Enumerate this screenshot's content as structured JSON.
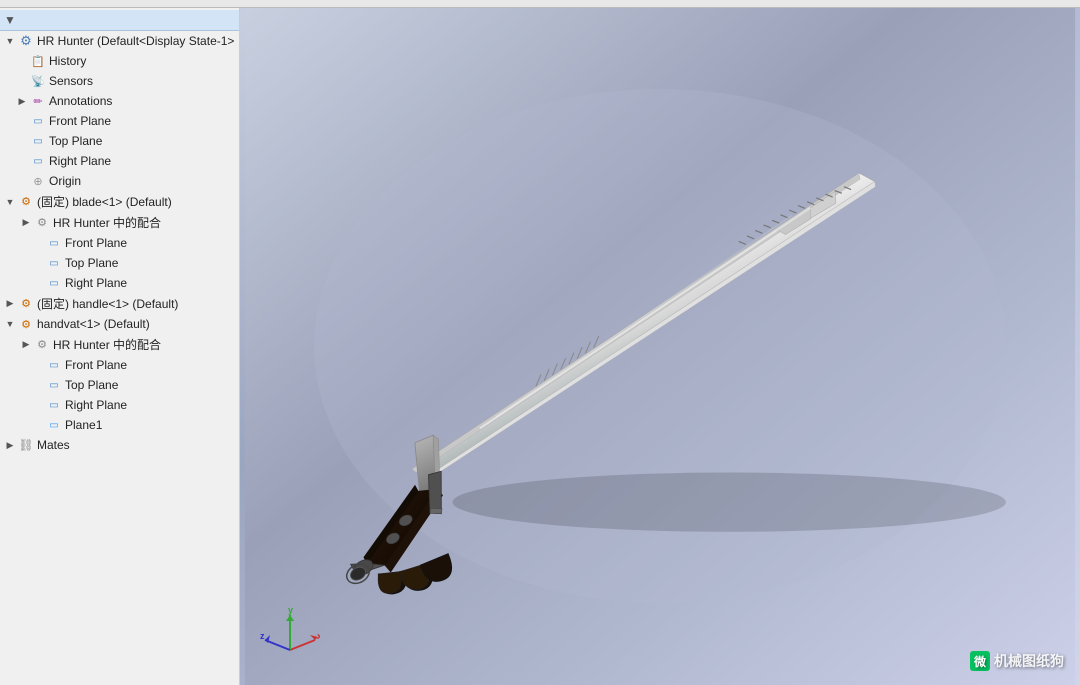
{
  "toolbar": {
    "filter_icon": "▼"
  },
  "sidebar": {
    "root_item": "HR Hunter  (Default<Display State-1>",
    "items": [
      {
        "id": "history",
        "label": "History",
        "icon": "H",
        "indent": 1,
        "type": "history",
        "expanded": false
      },
      {
        "id": "sensors",
        "label": "Sensors",
        "icon": "S",
        "indent": 1,
        "type": "sensor",
        "expanded": false
      },
      {
        "id": "annotations",
        "label": "Annotations",
        "icon": "A",
        "indent": 1,
        "type": "annotation",
        "expanded": false,
        "has_arrow": true
      },
      {
        "id": "front-plane",
        "label": "Front Plane",
        "icon": "P",
        "indent": 1,
        "type": "plane"
      },
      {
        "id": "top-plane",
        "label": "Top Plane",
        "icon": "P",
        "indent": 1,
        "type": "plane"
      },
      {
        "id": "right-plane",
        "label": "Right Plane",
        "icon": "P",
        "indent": 1,
        "type": "plane"
      },
      {
        "id": "origin",
        "label": "Origin",
        "icon": "O",
        "indent": 1,
        "type": "origin"
      },
      {
        "id": "blade",
        "label": "(固定) blade<1> (Default)",
        "icon": "C",
        "indent": 0,
        "type": "assembly",
        "expanded": true,
        "has_arrow": true
      },
      {
        "id": "blade-mate",
        "label": "HR Hunter 中的配合",
        "icon": "M",
        "indent": 2,
        "type": "mate",
        "expanded": false,
        "has_arrow": true
      },
      {
        "id": "blade-front",
        "label": "Front Plane",
        "icon": "P",
        "indent": 2,
        "type": "plane"
      },
      {
        "id": "blade-top",
        "label": "Top Plane",
        "icon": "P",
        "indent": 2,
        "type": "plane"
      },
      {
        "id": "blade-right",
        "label": "Right Plane",
        "icon": "P",
        "indent": 2,
        "type": "plane"
      },
      {
        "id": "handle",
        "label": "(固定) handle<1> (Default)",
        "icon": "C",
        "indent": 0,
        "type": "assembly",
        "expanded": false,
        "has_arrow": true
      },
      {
        "id": "handvat",
        "label": "handvat<1> (Default)",
        "icon": "C",
        "indent": 0,
        "type": "assembly",
        "expanded": true,
        "has_arrow": true
      },
      {
        "id": "handvat-mate",
        "label": "HR Hunter 中的配合",
        "icon": "M",
        "indent": 2,
        "type": "mate",
        "expanded": false,
        "has_arrow": true
      },
      {
        "id": "handvat-front",
        "label": "Front Plane",
        "icon": "P",
        "indent": 2,
        "type": "plane"
      },
      {
        "id": "handvat-top",
        "label": "Top Plane",
        "icon": "P",
        "indent": 2,
        "type": "plane"
      },
      {
        "id": "handvat-right",
        "label": "Right Plane",
        "icon": "P",
        "indent": 2,
        "type": "plane"
      },
      {
        "id": "plane1",
        "label": "Plane1",
        "icon": "P",
        "indent": 2,
        "type": "plane"
      },
      {
        "id": "mates",
        "label": "Mates",
        "icon": "M",
        "indent": 0,
        "type": "mates",
        "has_arrow": true
      }
    ]
  },
  "viewport": {
    "watermark_icon": "微",
    "watermark_text": "机械图纸狗"
  },
  "axis": {
    "x_label": "x",
    "y_label": "y",
    "z_label": "z"
  }
}
